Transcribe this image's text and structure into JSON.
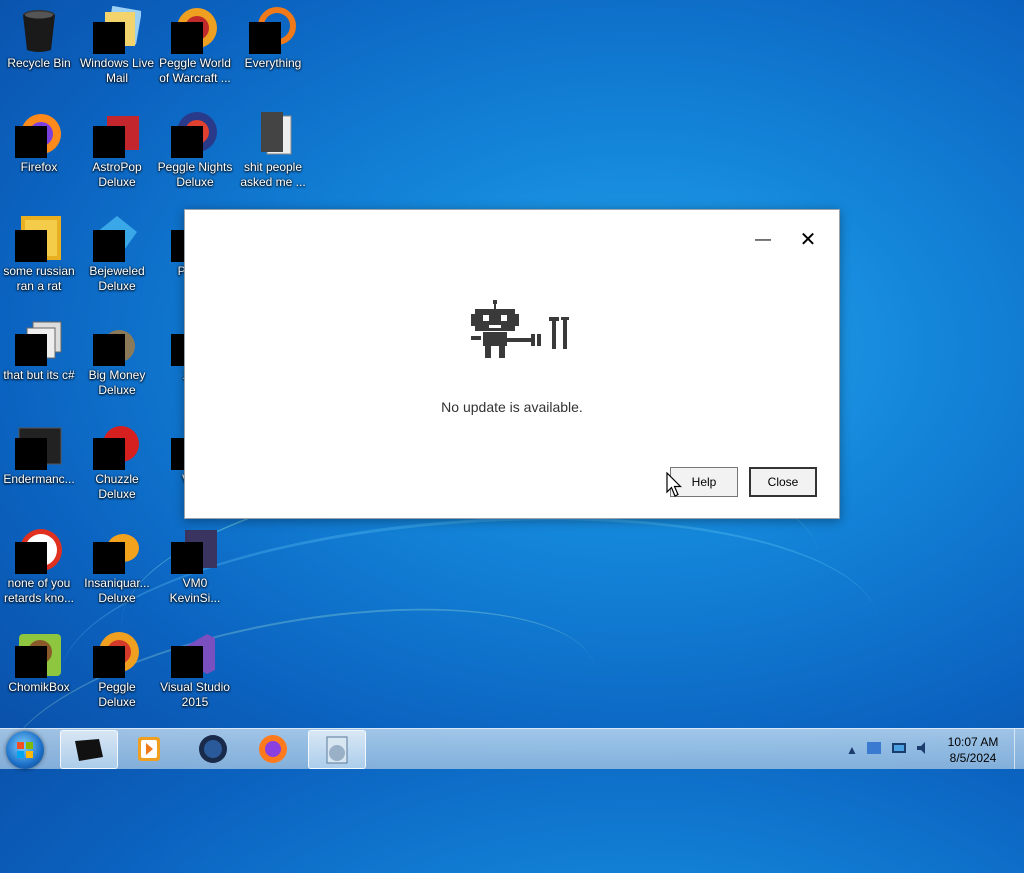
{
  "desktop": {
    "icons": [
      {
        "label": "Recycle Bin",
        "icon": "recycle-bin-icon"
      },
      {
        "label": "Windows Live Mail",
        "icon": "mail-app-icon"
      },
      {
        "label": "Peggle World of Warcraft ...",
        "icon": "game-icon"
      },
      {
        "label": "Everything",
        "icon": "search-app-icon"
      },
      {
        "label": "Firefox",
        "icon": "firefox-icon"
      },
      {
        "label": "AstroPop Deluxe",
        "icon": "game-icon"
      },
      {
        "label": "Peggle Nights Deluxe",
        "icon": "game-icon"
      },
      {
        "label": "shit people asked me ...",
        "icon": "folder-icon"
      },
      {
        "label": "some russian ran a rat",
        "icon": "file-icon"
      },
      {
        "label": "Bejeweled Deluxe",
        "icon": "game-icon"
      },
      {
        "label": "Pla Zo",
        "icon": "game-icon"
      },
      {
        "label": "that but its c#",
        "icon": "file-icon"
      },
      {
        "label": "Big Money Deluxe",
        "icon": "game-icon"
      },
      {
        "label": "Zum",
        "icon": "game-icon"
      },
      {
        "label": "Endermanc...",
        "icon": "app-icon"
      },
      {
        "label": "Chuzzle Deluxe",
        "icon": "game-icon"
      },
      {
        "label": "V Ke",
        "icon": "app-icon"
      },
      {
        "label": "none of you retards kno...",
        "icon": "file-icon"
      },
      {
        "label": "Insaniquar... Deluxe",
        "icon": "game-icon"
      },
      {
        "label": "VM0 KevinSi...",
        "icon": "app-icon"
      },
      {
        "label": "ChomikBox",
        "icon": "app-icon"
      },
      {
        "label": "Peggle Deluxe",
        "icon": "game-icon"
      },
      {
        "label": "Visual Studio 2015",
        "icon": "visual-studio-icon"
      }
    ]
  },
  "dialog": {
    "message": "No update is available.",
    "minimize_glyph": "—",
    "close_glyph": "✕",
    "help_label": "Help",
    "close_label": "Close"
  },
  "taskbar": {
    "time": "10:07 AM",
    "date": "8/5/2024",
    "tray_arrow": "▲"
  }
}
